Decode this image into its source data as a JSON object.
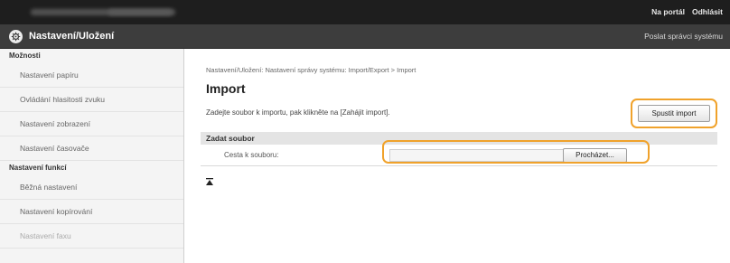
{
  "topbar": {
    "links": [
      "Na portál",
      "Odhlásit"
    ]
  },
  "header": {
    "icon": "printer-gear-icon",
    "title": "Nastavení/Uložení",
    "admin_link": "Poslat správci systému"
  },
  "sidebar": {
    "section1": "Možnosti",
    "items1": [
      "Nastavení papíru",
      "Ovládání hlasitosti zvuku",
      "Nastavení zobrazení",
      "Nastavení časovače"
    ],
    "section2": "Nastavení funkcí",
    "items2": [
      "Běžná nastavení",
      "Nastavení kopírování",
      "Nastavení faxu"
    ]
  },
  "main": {
    "breadcrumb": "Nastavení/Uložení: Nastavení správy systému: Import/Export > Import",
    "title": "Import",
    "instruction": "Zadejte soubor k importu, pak klikněte na [Zahájit import].",
    "start_button": "Spustit import",
    "section_title": "Zadat soubor",
    "file_label": "Cesta k souboru:",
    "file_value": "",
    "browse_button": "Procházet...",
    "highlight_color": "#f0a22b"
  }
}
